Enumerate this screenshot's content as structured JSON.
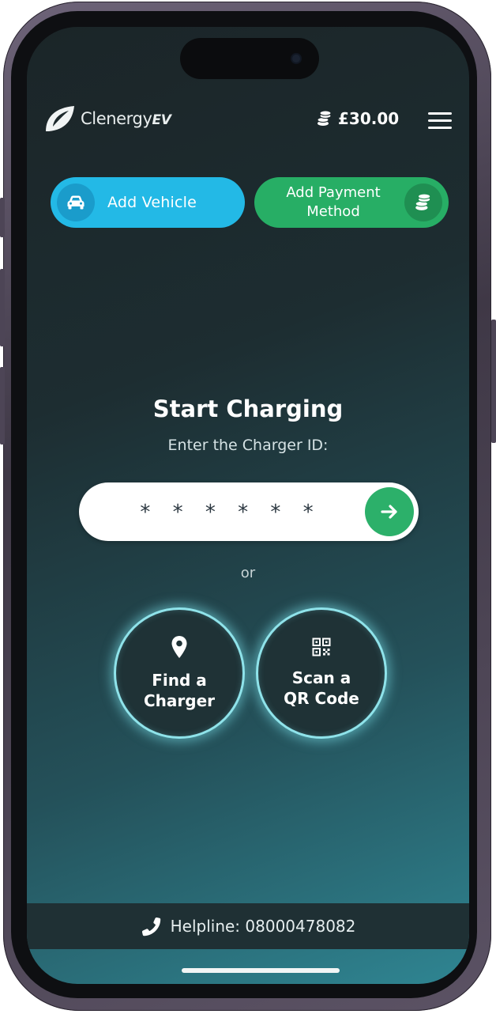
{
  "header": {
    "logo_text": "Clenergy",
    "logo_ev": "EV",
    "balance": "£30.00"
  },
  "actions": {
    "add_vehicle": "Add Vehicle",
    "add_payment_line1": "Add Payment",
    "add_payment_line2": "Method"
  },
  "start_charging": {
    "title": "Start Charging",
    "subtitle": "Enter the Charger ID:",
    "input_placeholder": "* * * * * *",
    "or_text": "or"
  },
  "options": {
    "find_charger": "Find a\nCharger",
    "scan_qr": "Scan a\nQR Code"
  },
  "footer": {
    "helpline": "Helpline: 08000478082"
  },
  "colors": {
    "vehicle_button": "#23b9e6",
    "payment_button": "#27ae65",
    "go_button": "#2cb06a",
    "glow": "#8fe3ea"
  },
  "icons": {
    "logo": "leaf-logo-icon",
    "balance": "coins-icon",
    "menu": "hamburger-menu-icon",
    "vehicle": "car-icon",
    "payment": "coins-icon",
    "go": "arrow-right-icon",
    "find": "map-pin-icon",
    "scan": "qr-code-icon",
    "phone": "phone-icon"
  }
}
